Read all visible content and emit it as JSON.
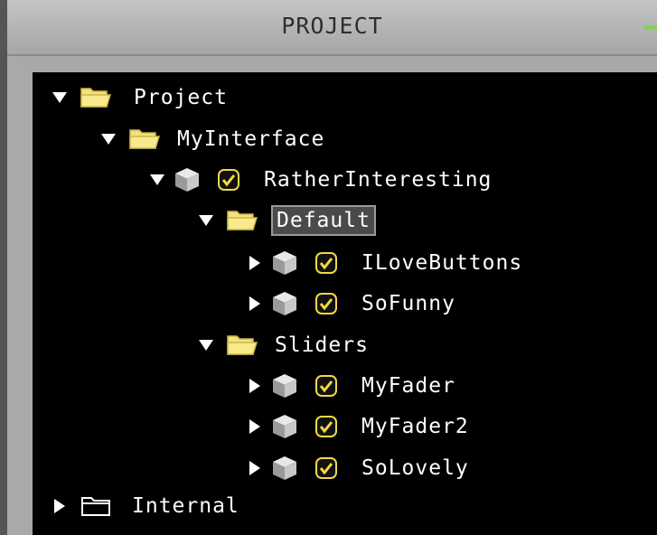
{
  "panel": {
    "title": "PROJECT"
  },
  "tree": {
    "project": "Project",
    "my_interface": "MyInterface",
    "rather_interesting": "RatherInteresting",
    "default": "Default",
    "i_love_buttons": "ILoveButtons",
    "so_funny": "SoFunny",
    "sliders": "Sliders",
    "my_fader": "MyFader",
    "my_fader2": "MyFader2",
    "so_lovely": "SoLovely",
    "internal": "Internal"
  },
  "colors": {
    "folder_yellow": "#f4e37a",
    "check_yellow": "#f2d944",
    "minimize_green": "#7fd35a"
  }
}
